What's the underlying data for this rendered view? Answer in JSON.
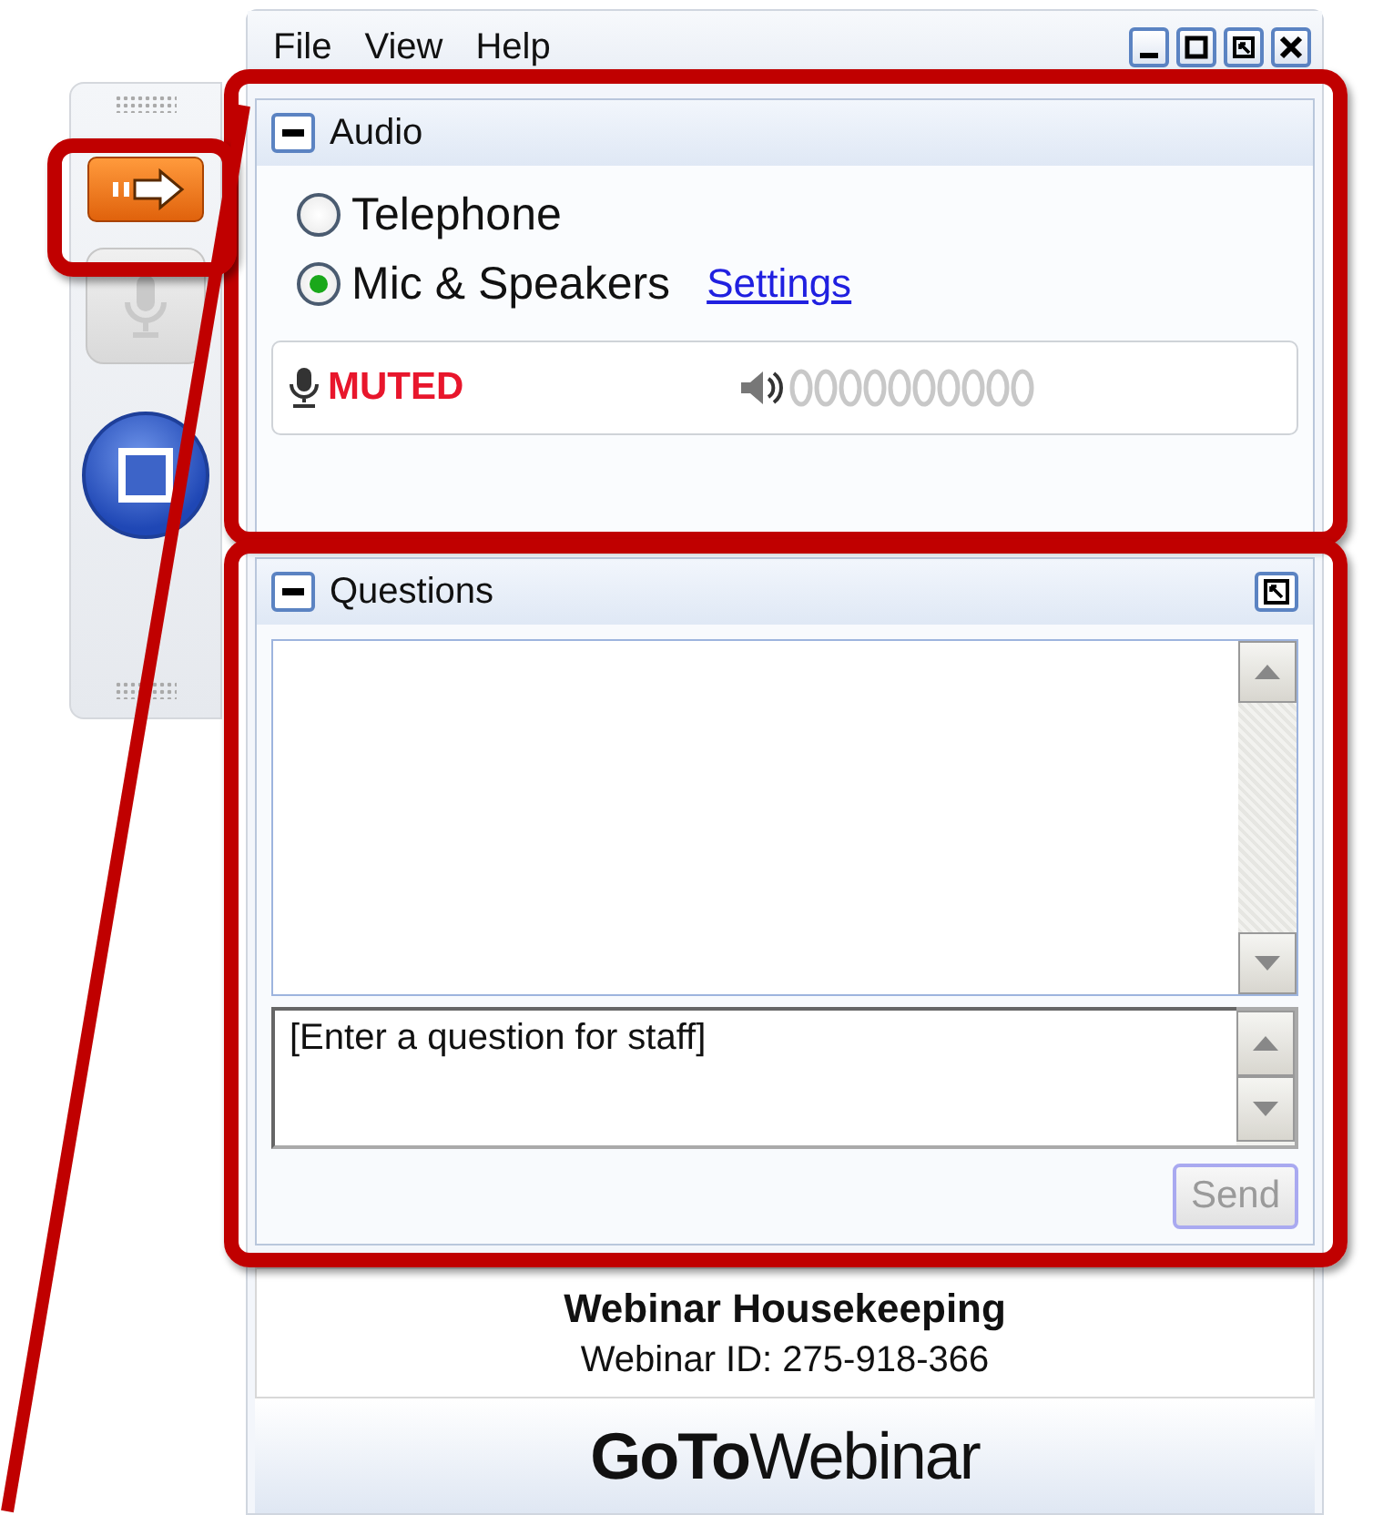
{
  "menu": [
    "File",
    "View",
    "Help"
  ],
  "window_controls": [
    {
      "kind": "minimize"
    },
    {
      "kind": "maximize"
    },
    {
      "kind": "restore"
    },
    {
      "kind": "close"
    }
  ],
  "sidebar_buttons": [
    {
      "kind": "arrow",
      "disabled": false
    },
    {
      "kind": "mic",
      "disabled": true
    },
    {
      "kind": "screen",
      "disabled": false
    }
  ],
  "audio": {
    "title": "Audio",
    "options": [
      {
        "label": "Telephone",
        "selected": false
      },
      {
        "label": "Mic & Speakers",
        "selected": true
      }
    ],
    "settings_link": "Settings",
    "mic_status": "MUTED"
  },
  "questions": {
    "title": "Questions",
    "input": {
      "placeholder": "[Enter a question for staff]"
    },
    "send_button": {
      "label": "Send",
      "disabled": true
    }
  },
  "footer": {
    "title": "Webinar Housekeeping",
    "webinar_id": "Webinar ID: 275-918-366"
  },
  "logo": {
    "bold": "GoTo",
    "light": "Webinar"
  }
}
